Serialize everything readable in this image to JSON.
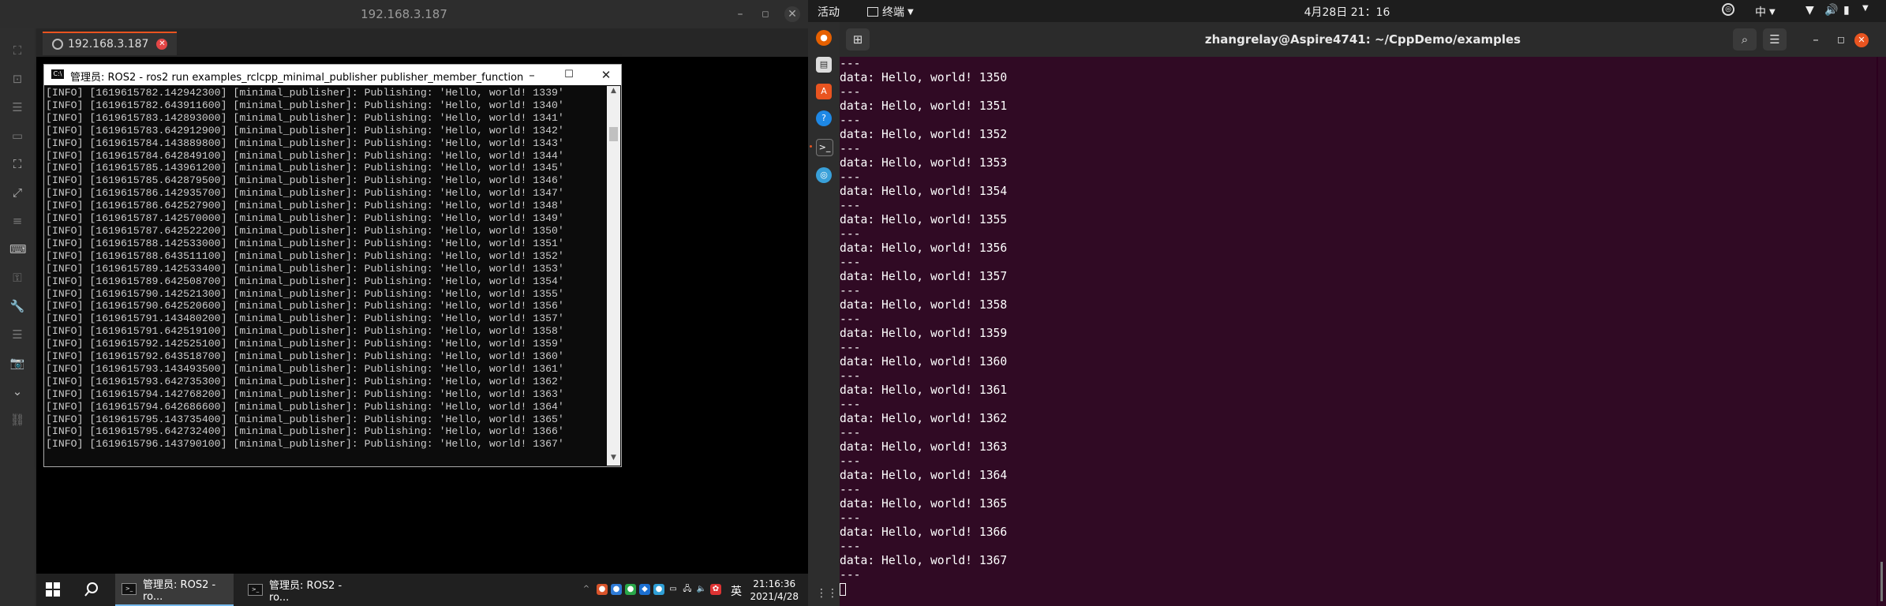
{
  "rdp": {
    "window_title": "192.168.3.187",
    "tab_label": "192.168.3.187",
    "minimize": "–",
    "maximize": "◻",
    "close": "✕"
  },
  "cmd": {
    "title": "管理员: ROS2 - ros2  run examples_rclcpp_minimal_publisher publisher_member_function",
    "icon": "C:\\",
    "lines": [
      "[INFO] [1619615782.142942300] [minimal_publisher]: Publishing: 'Hello, world! 1339'",
      "[INFO] [1619615782.643911600] [minimal_publisher]: Publishing: 'Hello, world! 1340'",
      "[INFO] [1619615783.142893000] [minimal_publisher]: Publishing: 'Hello, world! 1341'",
      "[INFO] [1619615783.642912900] [minimal_publisher]: Publishing: 'Hello, world! 1342'",
      "[INFO] [1619615784.143889800] [minimal_publisher]: Publishing: 'Hello, world! 1343'",
      "[INFO] [1619615784.642849100] [minimal_publisher]: Publishing: 'Hello, world! 1344'",
      "[INFO] [1619615785.143961200] [minimal_publisher]: Publishing: 'Hello, world! 1345'",
      "[INFO] [1619615785.642879500] [minimal_publisher]: Publishing: 'Hello, world! 1346'",
      "[INFO] [1619615786.142935700] [minimal_publisher]: Publishing: 'Hello, world! 1347'",
      "[INFO] [1619615786.642527900] [minimal_publisher]: Publishing: 'Hello, world! 1348'",
      "[INFO] [1619615787.142570000] [minimal_publisher]: Publishing: 'Hello, world! 1349'",
      "[INFO] [1619615787.642522200] [minimal_publisher]: Publishing: 'Hello, world! 1350'",
      "[INFO] [1619615788.142533000] [minimal_publisher]: Publishing: 'Hello, world! 1351'",
      "[INFO] [1619615788.643511100] [minimal_publisher]: Publishing: 'Hello, world! 1352'",
      "[INFO] [1619615789.142533400] [minimal_publisher]: Publishing: 'Hello, world! 1353'",
      "[INFO] [1619615789.642508700] [minimal_publisher]: Publishing: 'Hello, world! 1354'",
      "[INFO] [1619615790.142521300] [minimal_publisher]: Publishing: 'Hello, world! 1355'",
      "[INFO] [1619615790.642520600] [minimal_publisher]: Publishing: 'Hello, world! 1356'",
      "[INFO] [1619615791.143480200] [minimal_publisher]: Publishing: 'Hello, world! 1357'",
      "[INFO] [1619615791.642519100] [minimal_publisher]: Publishing: 'Hello, world! 1358'",
      "[INFO] [1619615792.142525100] [minimal_publisher]: Publishing: 'Hello, world! 1359'",
      "[INFO] [1619615792.643518700] [minimal_publisher]: Publishing: 'Hello, world! 1360'",
      "[INFO] [1619615793.143493500] [minimal_publisher]: Publishing: 'Hello, world! 1361'",
      "[INFO] [1619615793.642735300] [minimal_publisher]: Publishing: 'Hello, world! 1362'",
      "[INFO] [1619615794.142768200] [minimal_publisher]: Publishing: 'Hello, world! 1363'",
      "[INFO] [1619615794.642686600] [minimal_publisher]: Publishing: 'Hello, world! 1364'",
      "[INFO] [1619615795.143735400] [minimal_publisher]: Publishing: 'Hello, world! 1365'",
      "[INFO] [1619615795.642732400] [minimal_publisher]: Publishing: 'Hello, world! 1366'",
      "[INFO] [1619615796.143790100] [minimal_publisher]: Publishing: 'Hello, world! 1367'"
    ]
  },
  "win_taskbar": {
    "apps": [
      "管理员: ROS2 - ro...",
      "管理员: ROS2 - ro..."
    ],
    "ime": "英",
    "time": "21:16:36",
    "date": "2021/4/28"
  },
  "ubuntu": {
    "activities": "活动",
    "app_menu": "终端",
    "clock": "4月28日  21：16",
    "input_method": "中",
    "terminal_title": "zhangrelay@Aspire4741: ~/CppDemo/examples",
    "sep": "---",
    "data_lines": [
      "data: Hello, world! 1350",
      "data: Hello, world! 1351",
      "data: Hello, world! 1352",
      "data: Hello, world! 1353",
      "data: Hello, world! 1354",
      "data: Hello, world! 1355",
      "data: Hello, world! 1356",
      "data: Hello, world! 1357",
      "data: Hello, world! 1358",
      "data: Hello, world! 1359",
      "data: Hello, world! 1360",
      "data: Hello, world! 1361",
      "data: Hello, world! 1362",
      "data: Hello, world! 1363",
      "data: Hello, world! 1364",
      "data: Hello, world! 1365",
      "data: Hello, world! 1366",
      "data: Hello, world! 1367"
    ],
    "accent": "#e95420",
    "background": "#300a24"
  }
}
